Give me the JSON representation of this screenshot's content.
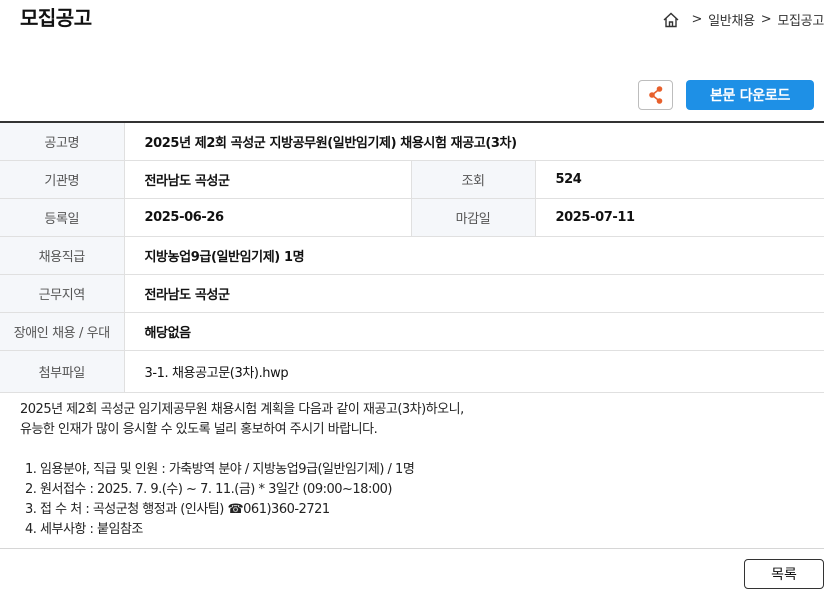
{
  "page": {
    "title": "모집공고"
  },
  "breadcrumb": {
    "items": [
      "일반채용",
      "모집공고"
    ],
    "separator": ">"
  },
  "toolbar": {
    "download_label": "본문 다운로드"
  },
  "info": {
    "title_label": "공고명",
    "title_value": "2025년 제2회 곡성군 지방공무원(일반임기제) 채용시험 재공고(3차)",
    "agency_label": "기관명",
    "agency_value": "전라남도 곡성군",
    "views_label": "조회",
    "views_value": "524",
    "reg_label": "등록일",
    "reg_value": "2025-06-26",
    "deadline_label": "마감일",
    "deadline_value": "2025-07-11",
    "grade_label": "채용직급",
    "grade_value": "지방농업9급(일반임기제) 1명",
    "region_label": "근무지역",
    "region_value": "전라남도 곡성군",
    "disability_label": "장애인 채용 / 우대",
    "disability_value": "해당없음",
    "attach_label": "첨부파일",
    "attach_value": "3-1. 채용공고문(3차).hwp"
  },
  "body": {
    "line1": "2025년 제2회 곡성군 임기제공무원 채용시험 계획을 다음과 같이 재공고(3차)하오니,",
    "line2": "유능한 인재가 많이 응시할 수 있도록 널리 홍보하여 주시기 바랍니다.",
    "items": [
      "1. 임용분야, 직급 및 인원 : 가축방역 분야 / 지방농업9급(일반임기제) / 1명",
      "2. 원서접수 : 2025. 7. 9.(수) ~ 7. 11.(금) * 3일간 (09:00~18:00)",
      "3. 접 수 처 : 곡성군청 행정과 (인사팀) ☎061)360-2721",
      "4. 세부사항 : 붙임참조"
    ]
  },
  "footer": {
    "list_label": "목록"
  }
}
